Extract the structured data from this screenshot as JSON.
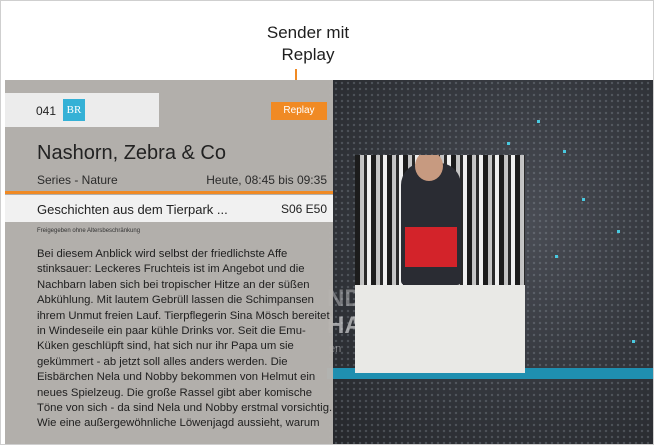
{
  "callout": {
    "label_line1": "Sender mit",
    "label_line2": "Replay"
  },
  "channel": {
    "number": "041",
    "logo_text": "BR"
  },
  "replay": {
    "label": "Replay"
  },
  "program": {
    "title": "Nashorn, Zebra & Co",
    "genre": "Series - Nature",
    "time": "Heute, 08:45 bis 09:35"
  },
  "episode": {
    "title": "Geschichten aus dem Tierpark ...",
    "code": "S06 E50"
  },
  "age_rating": "Freigegeben ohne Altersbeschränkung",
  "description": "Bei diesem Anblick wird selbst der friedlichste Affe stinksauer: Leckeres Fruchteis ist im Angebot und die Nachbarn laben sich bei tropischer Hitze an der süßen Abkühlung. Mit lautem Gebrüll lassen die Schimpansen ihrem Unmut freien Lauf. Tierpflegerin Sina Mösch bereitet in Windeseile ein paar kühle Drinks vor. Seit die Emu-Küken geschlüpft sind, hat sich nur ihr Papa um sie gekümmert - ab jetzt soll alles anders werden. Die Eisbärchen Nela und Nobby bekommen von Helmut ein neues Spielzeug. Die große Rassel gibt aber komische Töne von sich - da sind Nela und Nobby erstmal vorsichtig. Wie eine außergewöhnliche Löwenjagd aussieht, warum",
  "background_text": {
    "line1": "ND",
    "line2": "HAU",
    "line3": "en"
  },
  "colors": {
    "accent": "#f08a24",
    "logo": "#35b1d6",
    "teal_bar": "#1f8fb0"
  }
}
